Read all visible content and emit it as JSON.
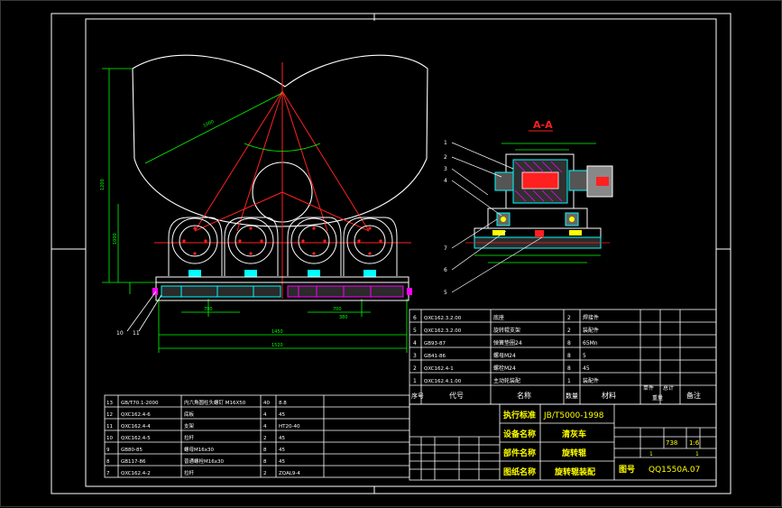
{
  "section_title": "A-A",
  "colors": {
    "background": "#000000",
    "frame": "#ffffff",
    "red": "#ff2020",
    "green": "#00ff00",
    "cyan": "#00ffff",
    "yellow": "#ffff00",
    "magenta": "#ff00ff",
    "blue": "#4444ff"
  },
  "callouts_left": [
    "10",
    "11"
  ],
  "callouts_right": [
    "1",
    "2",
    "3",
    "4",
    "7",
    "6",
    "5"
  ],
  "dims": {
    "d1": "1520",
    "d2": "1450",
    "d3": "700",
    "d4": "700",
    "d5": "1200",
    "d6": "1000",
    "d7": "1000",
    "d8": "380"
  },
  "parts_upper": [
    {
      "no": "6",
      "code": "QXC162.3.2.00",
      "name": "底座",
      "qty": "2",
      "mat": "焊接件"
    },
    {
      "no": "5",
      "code": "QXC162.3.2.00",
      "name": "旋转辊支架",
      "qty": "2",
      "mat": "装配件"
    },
    {
      "no": "4",
      "code": "GB93-87",
      "name": "弹簧垫圈24",
      "qty": "8",
      "mat": "65Mn"
    },
    {
      "no": "3",
      "code": "GB41-86",
      "name": "螺母M24",
      "qty": "8",
      "mat": "5"
    },
    {
      "no": "2",
      "code": "QXC162.4-1",
      "name": "螺栓M24",
      "qty": "8",
      "mat": "45"
    },
    {
      "no": "1",
      "code": "QXC162.4.1.00",
      "name": "主动轮装配",
      "qty": "1",
      "mat": "装配件"
    }
  ],
  "header_upper": {
    "no": "序号",
    "code": "代号",
    "name": "名称",
    "qty": "数量",
    "mat": "材料",
    "single": "单件",
    "total": "总计",
    "weight": "重量",
    "remark": "备注"
  },
  "parts_lower": [
    {
      "no": "13",
      "code": "GB/T70.1-2000",
      "name": "内六角圆柱头螺钉 M16X50",
      "qty": "40",
      "mat": "8.8"
    },
    {
      "no": "12",
      "code": "QXC162.4-6",
      "name": "底板",
      "qty": "4",
      "mat": "45"
    },
    {
      "no": "11",
      "code": "QXC162.4-4",
      "name": "支架",
      "qty": "4",
      "mat": "HT20-40"
    },
    {
      "no": "10",
      "code": "QXC162.4-5",
      "name": "拉杆",
      "qty": "2",
      "mat": "45"
    },
    {
      "no": "9",
      "code": "GB80-85",
      "name": "螺母M16x30",
      "qty": "8",
      "mat": "45"
    },
    {
      "no": "8",
      "code": "GB117-86",
      "name": "普通螺栓M16x30",
      "qty": "8",
      "mat": "45"
    },
    {
      "no": "7",
      "code": "QXC162.4-2",
      "name": "拉杆",
      "qty": "2",
      "mat": "ZQAL9-4"
    }
  ],
  "title_block": {
    "std_label": "执行标准",
    "std_value": "JB/T5000-1998",
    "equip_label": "设备名称",
    "equip_value": "清灰车",
    "part_label": "部件名称",
    "part_value": "旋转辊",
    "drawing_label": "图纸名称",
    "drawing_value": "旋转辊装配",
    "drawing_no_label": "图号",
    "drawing_no_value": "QQ1550A.07",
    "scale": "1:6",
    "weight": "738",
    "sheet": "1",
    "sheets": "1"
  }
}
